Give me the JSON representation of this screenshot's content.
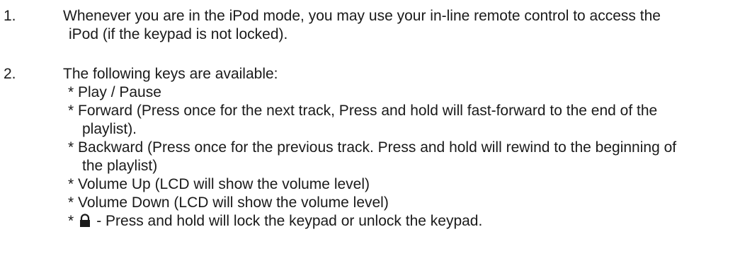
{
  "items": [
    {
      "number": "1.",
      "lines": [
        "Whenever you are in the  iPod mode, you may use your in-line remote control to access the",
        "iPod (if the keypad is not locked)."
      ]
    },
    {
      "number": "2.",
      "intro": "The following keys are available:",
      "bullets": [
        "* Play / Pause",
        "* Forward (Press once for the next track, Press and hold will fast-forward to the end of the",
        "playlist).",
        "* Backward (Press once for the previous track. Press and hold will rewind to the beginning of",
        "the playlist)",
        "* Volume Up (LCD will show the volume level)",
        "* Volume Down  (LCD will show the volume level)"
      ],
      "lock_bullet": {
        "star": "*",
        "icon": "lock-icon",
        "text": "- Press and hold will lock the keypad or unlock the keypad."
      }
    }
  ]
}
